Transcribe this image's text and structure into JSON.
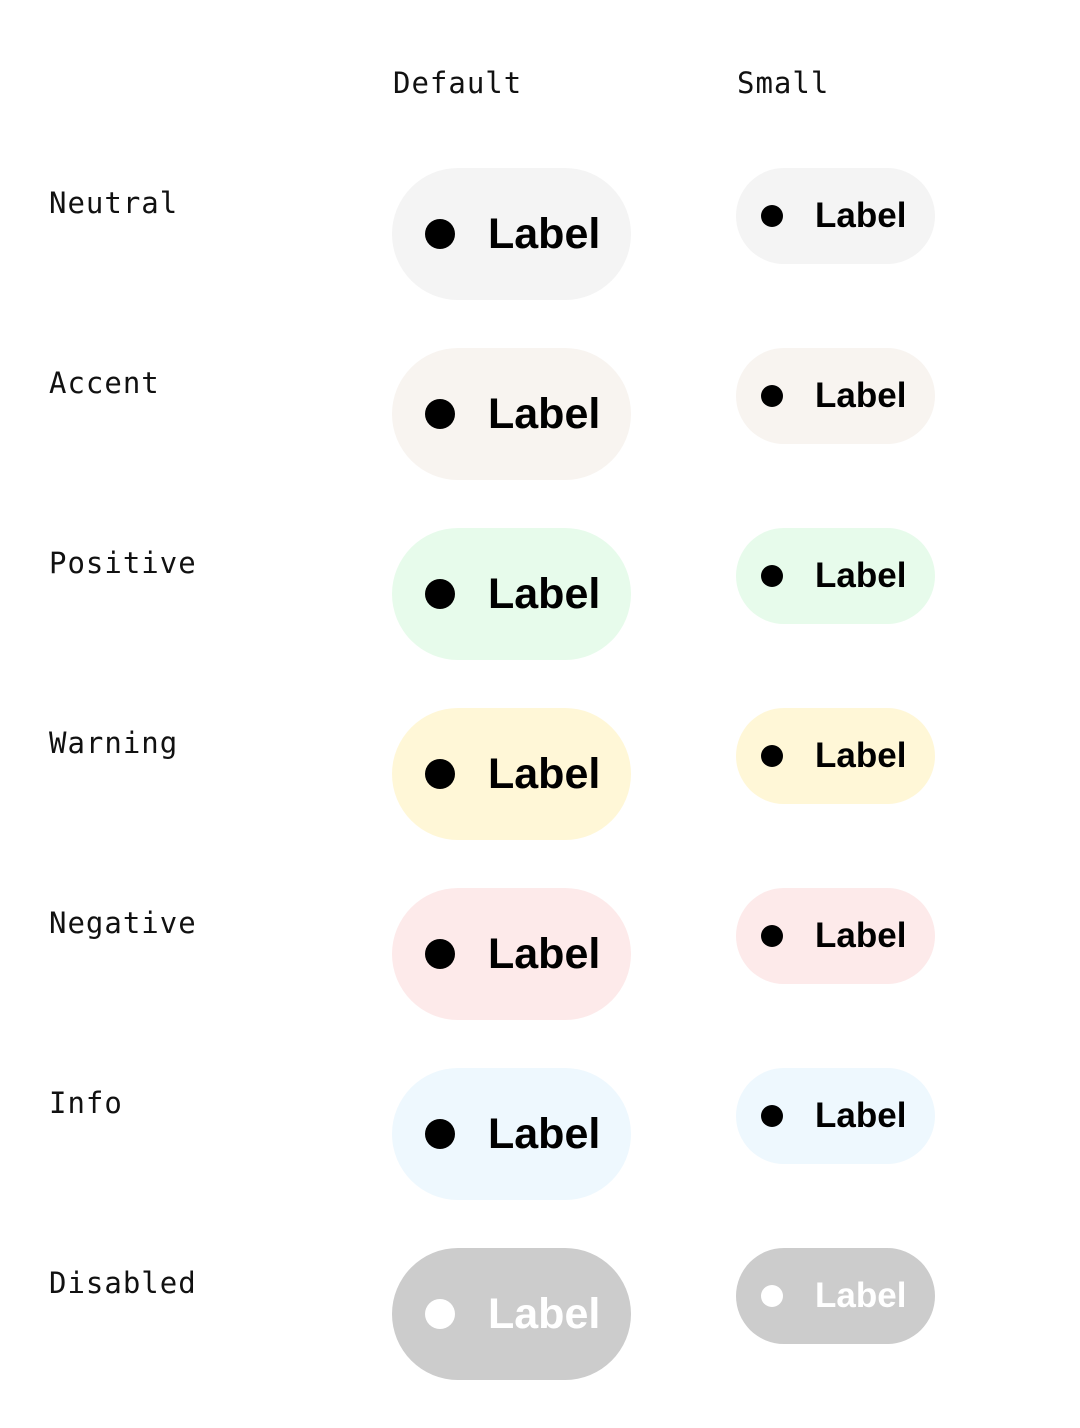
{
  "columns": {
    "default": "Default",
    "small": "Small"
  },
  "rows": [
    {
      "name": "Neutral",
      "label": "Label",
      "bg": "#f4f4f4",
      "dot": "#000000",
      "text": "#000000"
    },
    {
      "name": "Accent",
      "label": "Label",
      "bg": "#f8f4f0",
      "dot": "#000000",
      "text": "#000000"
    },
    {
      "name": "Positive",
      "label": "Label",
      "bg": "#e7fbeb",
      "dot": "#000000",
      "text": "#000000"
    },
    {
      "name": "Warning",
      "label": "Label",
      "bg": "#fff7d7",
      "dot": "#000000",
      "text": "#000000"
    },
    {
      "name": "Negative",
      "label": "Label",
      "bg": "#fdeaea",
      "dot": "#000000",
      "text": "#000000"
    },
    {
      "name": "Info",
      "label": "Label",
      "bg": "#eef8fe",
      "dot": "#000000",
      "text": "#000000"
    },
    {
      "name": "Disabled",
      "label": "Label",
      "bg": "#cccccc",
      "dot": "#ffffff",
      "text": "#ffffff"
    }
  ]
}
